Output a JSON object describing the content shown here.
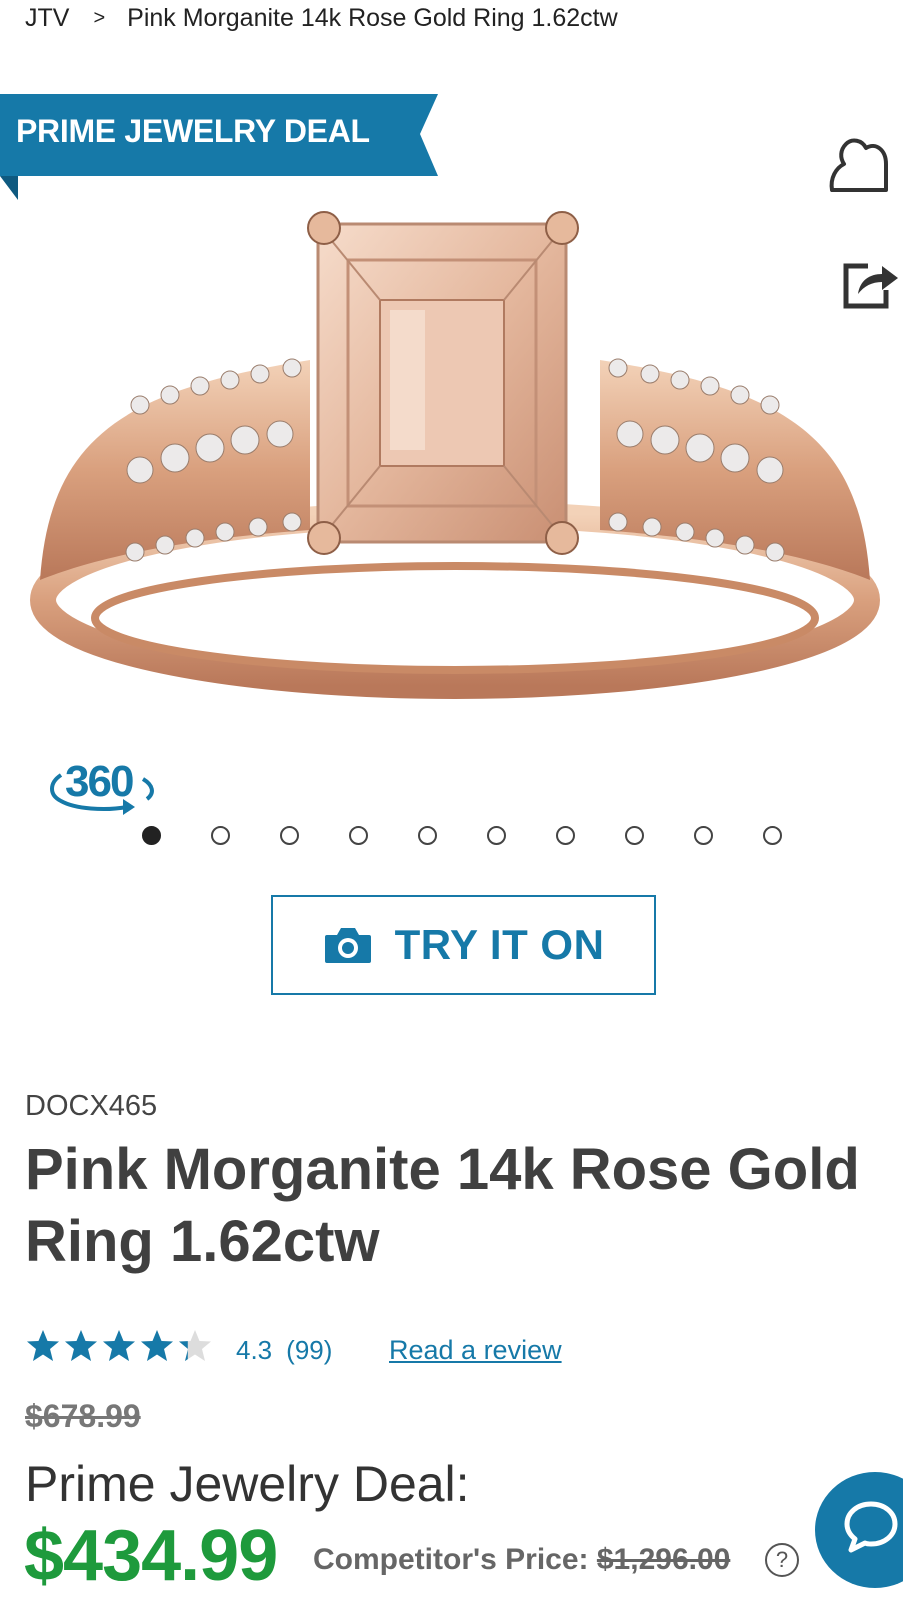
{
  "breadcrumb": {
    "home": "JTV",
    "separator": ">",
    "current": "Pink Morganite 14k Rose Gold Ring 1.62ctw"
  },
  "banner": {
    "text": "PRIME JEWELRY DEAL",
    "color": "#1679a8"
  },
  "actions": {
    "wishlist_icon": "heart-icon",
    "share_icon": "share-icon"
  },
  "gallery": {
    "view_360_label": "360",
    "dots_total": 10,
    "active_dot": 0,
    "image_alt": "Pink Morganite 14k Rose Gold Ring"
  },
  "try_on": {
    "label": "TRY IT ON",
    "icon": "camera-icon"
  },
  "product": {
    "sku": "DOCX465",
    "title": "Pink Morganite 14k Rose Gold Ring 1.62ctw",
    "rating_value": "4.3",
    "rating_stars": 4.3,
    "review_count": "(99)",
    "read_review_label": "Read a review"
  },
  "pricing": {
    "original_price": "$678.99",
    "deal_label": "Prime Jewelry Deal:",
    "deal_price": "$434.99",
    "competitor_label": "Competitor's Price:",
    "competitor_price": "$1,296.00",
    "help_symbol": "?"
  },
  "chat": {
    "icon": "chat-bubble-icon"
  },
  "colors": {
    "accent": "#1679a8",
    "deal_price": "#1e9a3c",
    "star": "#1679a8"
  }
}
